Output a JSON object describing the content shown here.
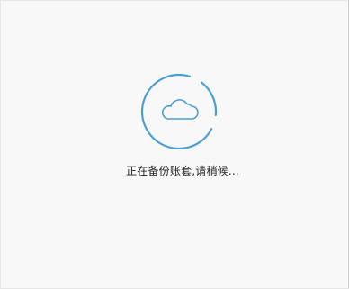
{
  "dialog": {
    "status_text": "正在备份账套,请稍候..."
  },
  "icons": {
    "spinner": "progress-ring-icon",
    "center": "cloud-icon"
  },
  "colors": {
    "background": "#f8f8f8",
    "accent": "#4aa0d2",
    "text": "#222222"
  }
}
